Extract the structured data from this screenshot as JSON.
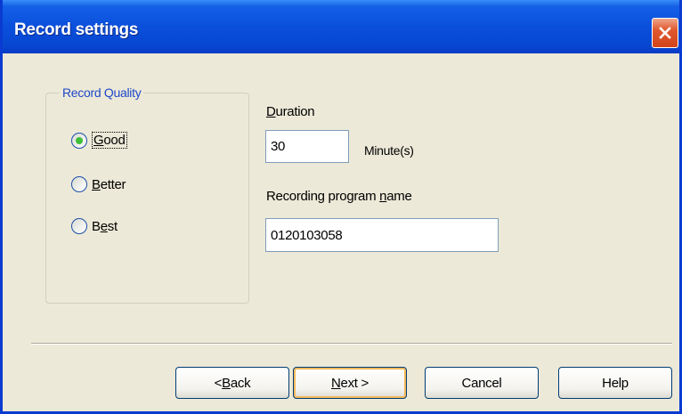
{
  "window": {
    "title": "Record settings",
    "close_icon": "close-icon"
  },
  "quality": {
    "legend": "Record Quality",
    "options": [
      {
        "pre": "",
        "ul": "G",
        "post": "ood",
        "checked": true
      },
      {
        "pre": "",
        "ul": "B",
        "post": "etter",
        "checked": false
      },
      {
        "pre": "B",
        "ul": "e",
        "post": "st",
        "checked": false
      }
    ]
  },
  "duration": {
    "label_ul": "D",
    "label_rest": "uration",
    "value": "30",
    "unit": "Minute(s)"
  },
  "program_name": {
    "label_pre": "Recording program ",
    "label_ul": "n",
    "label_post": "ame",
    "value": "0120103058"
  },
  "buttons": {
    "back_pre": "< ",
    "back_ul": "B",
    "back_post": "ack",
    "next_ul": "N",
    "next_post": "ext >",
    "cancel": "Cancel",
    "help": "Help"
  }
}
